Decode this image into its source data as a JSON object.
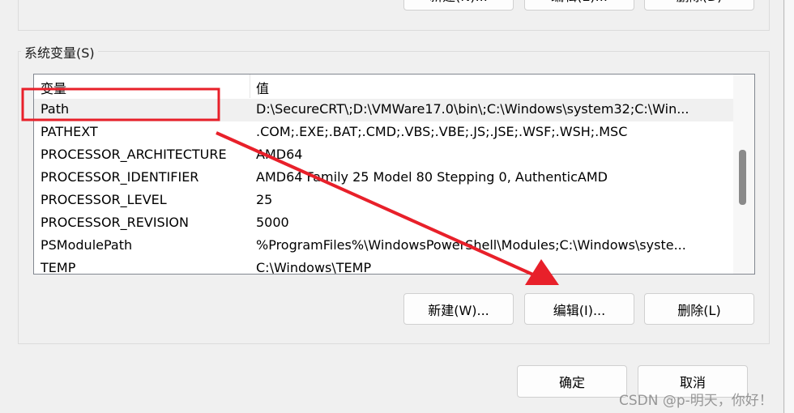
{
  "top_buttons": [
    "新建(N)...",
    "编辑(E)...",
    "删除(D)"
  ],
  "system_group": {
    "label": "系统变量(S)",
    "columns": [
      "变量",
      "值"
    ],
    "rows": [
      {
        "name": "Path",
        "value": "D:\\SecureCRT\\;D:\\VMWare17.0\\bin\\;C:\\Windows\\system32;C:\\Win..."
      },
      {
        "name": "PATHEXT",
        "value": ".COM;.EXE;.BAT;.CMD;.VBS;.VBE;.JS;.JSE;.WSF;.WSH;.MSC"
      },
      {
        "name": "PROCESSOR_ARCHITECTURE",
        "value": "AMD64"
      },
      {
        "name": "PROCESSOR_IDENTIFIER",
        "value": "AMD64 Family 25 Model 80 Stepping 0, AuthenticAMD"
      },
      {
        "name": "PROCESSOR_LEVEL",
        "value": "25"
      },
      {
        "name": "PROCESSOR_REVISION",
        "value": "5000"
      },
      {
        "name": "PSModulePath",
        "value": "%ProgramFiles%\\WindowsPowerShell\\Modules;C:\\Windows\\syste..."
      },
      {
        "name": "TEMP",
        "value": "C:\\Windows\\TEMP"
      }
    ],
    "buttons": {
      "new": "新建(W)...",
      "edit": "编辑(I)...",
      "delete": "删除(L)"
    }
  },
  "footer": {
    "ok": "确定",
    "cancel": "取消"
  },
  "watermark": "CSDN @p-明天，你好！",
  "annotation_color": "#e8202a"
}
